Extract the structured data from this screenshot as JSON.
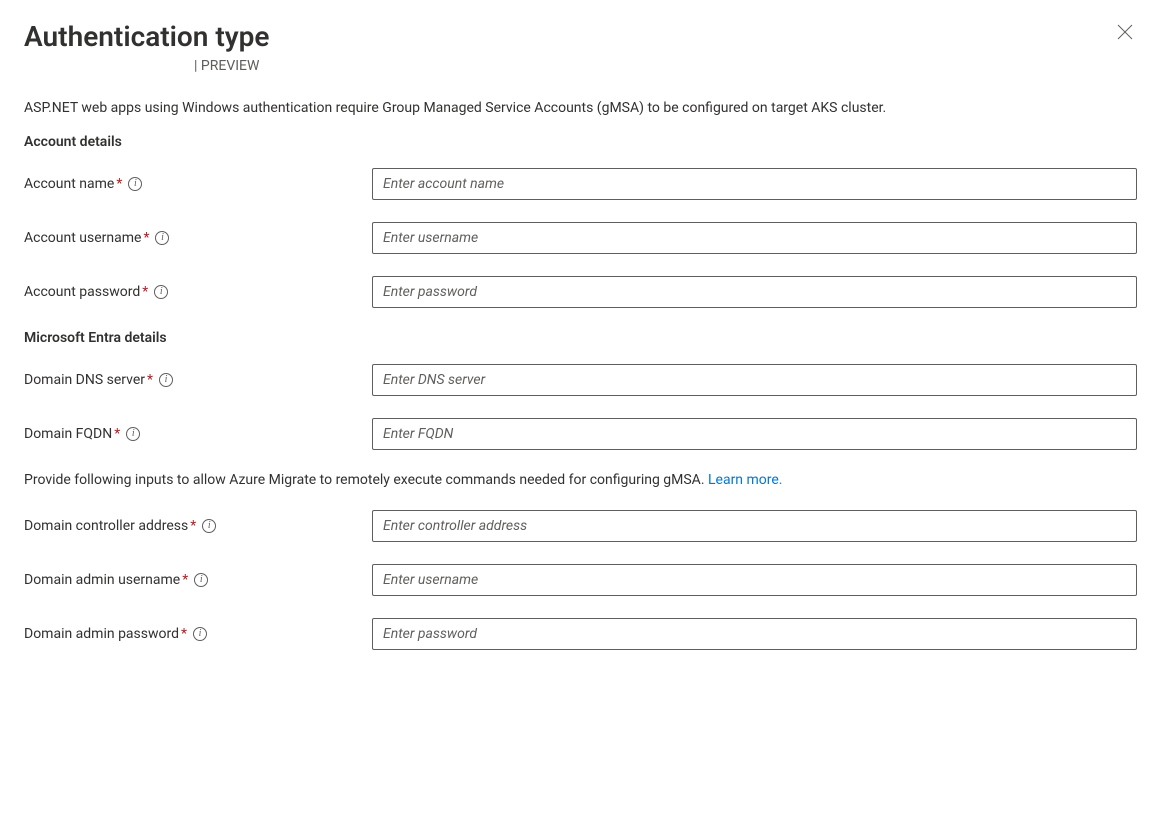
{
  "header": {
    "title": "Authentication type",
    "preview_separator": "|",
    "preview_label": "PREVIEW"
  },
  "description": "ASP.NET web apps using Windows authentication require Group Managed Service Accounts (gMSA) to be configured on target AKS cluster.",
  "sections": {
    "account": {
      "title": "Account details",
      "fields": {
        "name": {
          "label": "Account name",
          "placeholder": "Enter account name"
        },
        "username": {
          "label": "Account username",
          "placeholder": "Enter username"
        },
        "password": {
          "label": "Account password",
          "placeholder": "Enter password"
        }
      }
    },
    "entra": {
      "title": "Microsoft Entra details",
      "fields": {
        "dns": {
          "label": "Domain DNS server",
          "placeholder": "Enter DNS server"
        },
        "fqdn": {
          "label": "Domain FQDN",
          "placeholder": "Enter FQDN"
        }
      },
      "helper_text": "Provide following inputs to allow Azure Migrate to remotely execute commands needed for configuring gMSA. ",
      "learn_more": "Learn more.",
      "fields2": {
        "controller": {
          "label": "Domain controller address",
          "placeholder": "Enter controller address"
        },
        "admin_user": {
          "label": "Domain admin username",
          "placeholder": "Enter username"
        },
        "admin_pass": {
          "label": "Domain admin password",
          "placeholder": "Enter password"
        }
      }
    }
  },
  "required_marker": "*"
}
